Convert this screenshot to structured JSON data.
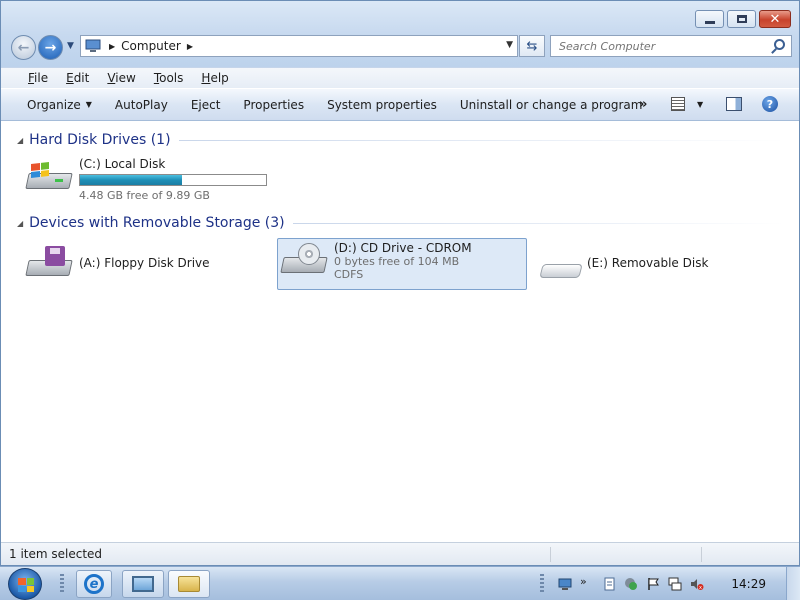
{
  "window": {
    "address": {
      "segments": [
        "Computer"
      ]
    },
    "search": {
      "placeholder": "Search Computer"
    },
    "menu": [
      {
        "label": "File"
      },
      {
        "label": "Edit"
      },
      {
        "label": "View"
      },
      {
        "label": "Tools"
      },
      {
        "label": "Help"
      }
    ],
    "commands": {
      "organize": "Organize",
      "autoplay": "AutoPlay",
      "eject": "Eject",
      "properties": "Properties",
      "system_properties": "System properties",
      "uninstall": "Uninstall or change a program",
      "more": "»"
    },
    "groups": {
      "hard_disks": {
        "title": "Hard Disk Drives (1)",
        "drives": {
          "c": {
            "name": "(C:) Local Disk",
            "free_text": "4.48 GB free of 9.89 GB",
            "used_fraction": 0.547
          }
        }
      },
      "removable": {
        "title": "Devices with Removable Storage (3)",
        "drives": {
          "a": {
            "name": "(A:) Floppy Disk Drive"
          },
          "d": {
            "name": "(D:) CD Drive - CDROM",
            "free_text": "0 bytes free of 104 MB",
            "fs": "CDFS",
            "selected": true
          },
          "e": {
            "name": "(E:) Removable Disk"
          }
        }
      }
    },
    "status": {
      "text": "1 item selected"
    }
  },
  "taskbar": {
    "clock": "14:29",
    "pinned": [
      "internet-explorer-icon",
      "computer-management-icon",
      "windows-explorer-icon"
    ]
  },
  "colors": {
    "accent": "#1e3287",
    "capacity_bar": "#1f8fb7",
    "selection": "#dde9f7"
  }
}
